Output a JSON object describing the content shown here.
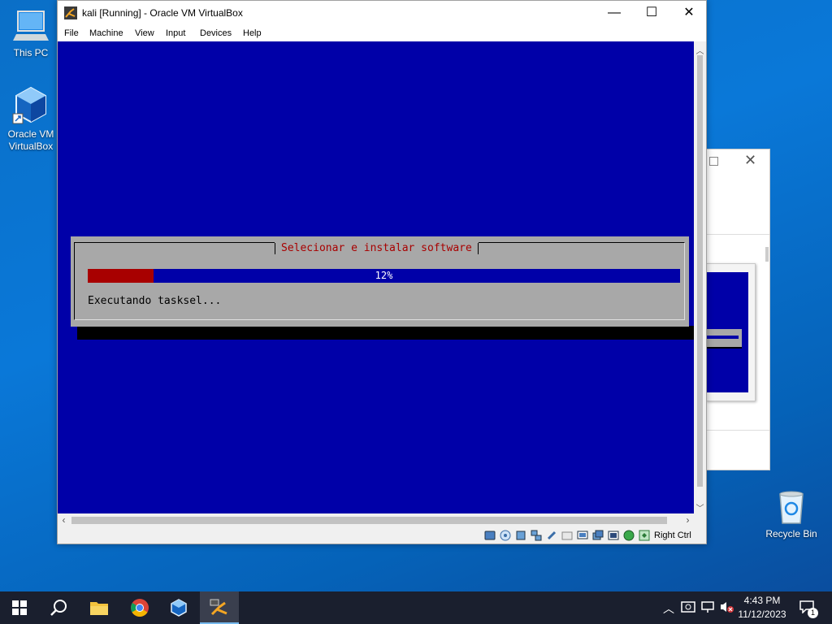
{
  "desktop": {
    "icons": [
      {
        "label": "This PC"
      },
      {
        "label": "Oracle VM VirtualBox"
      },
      {
        "label": "Recycle Bin"
      }
    ]
  },
  "window": {
    "title": "kali [Running] - Oracle VM VirtualBox",
    "controls": {
      "minimize": "—",
      "maximize": "☐",
      "close": "✕"
    },
    "menu": [
      "File",
      "Machine",
      "View",
      "Input",
      "Devices",
      "Help"
    ],
    "host_key": "Right Ctrl"
  },
  "installer": {
    "title": "Selecionar e instalar software",
    "progress_percent": 12,
    "progress_text": "12%",
    "message": "Executando tasksel...",
    "colors": {
      "background": "#0000a8",
      "dialog": "#a8a8a8",
      "title": "#a80000",
      "bar_fill": "#a80000"
    }
  },
  "taskbar": {
    "apps": [
      "start-icon",
      "search-icon",
      "file-explorer-icon",
      "chrome-icon",
      "virtualbox-icon",
      "kali-vm-icon"
    ],
    "time": "4:43 PM",
    "date": "11/12/2023",
    "notification_count": "1"
  }
}
